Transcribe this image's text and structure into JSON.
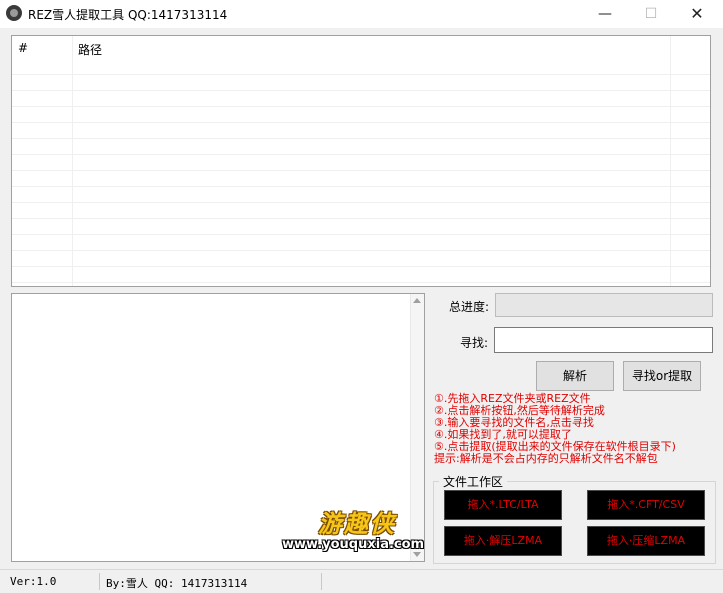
{
  "window": {
    "title": "REZ雪人提取工具 QQ:1417313114",
    "min_glyph": "—",
    "max_glyph": "☐",
    "close_glyph": "✕",
    "icon": "snowman-app-icon"
  },
  "list": {
    "columns": [
      "#",
      "路径"
    ],
    "rows": []
  },
  "watermark": {
    "cn": "游趣侠",
    "url": "www.youquxia.com"
  },
  "progress": {
    "label": "总进度:",
    "value": 0
  },
  "search": {
    "label": "寻找:",
    "value": ""
  },
  "buttons": {
    "parse": "解析",
    "search_extract": "寻找or提取"
  },
  "instructions": [
    "①.先拖入REZ文件夹或REZ文件",
    "②.点击解析按钮,然后等待解析完成",
    "③.输入要寻找的文件名,点击寻找",
    "④.如果找到了,就可以提取了",
    "⑤.点击提取(提取出来的文件保存在软件根目录下)",
    "提示:解析是不会占内存的只解析文件名不解包"
  ],
  "instruction_color": "#e00000",
  "workspace": {
    "title": "文件工作区",
    "drop_lic": "拖入*.LTC/LTA",
    "drop_cft": "拖入*.CFT/CSV",
    "drop_decompress": "拖入·解压LZMA",
    "drop_compress": "拖入·压缩LZMA"
  },
  "status": {
    "version": "Ver:1.0",
    "author": "By:雪人 QQ: 1417313114"
  }
}
